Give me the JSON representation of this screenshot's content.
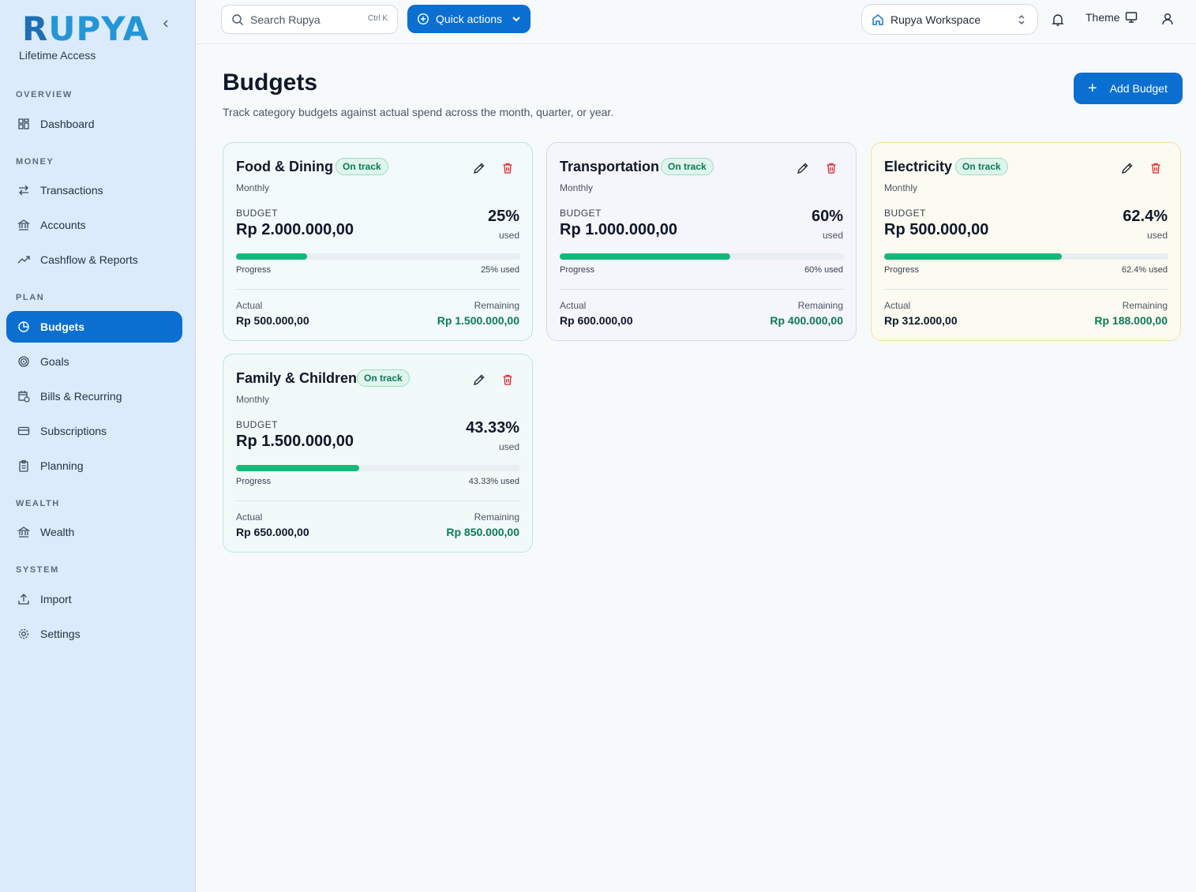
{
  "brand": {
    "name_first": "R",
    "name_rest": "UPYA",
    "subtitle": "Lifetime Access"
  },
  "sidebar": {
    "sections": [
      {
        "title": "OVERVIEW",
        "items": [
          {
            "label": "Dashboard",
            "icon": "dashboard-icon"
          }
        ]
      },
      {
        "title": "MONEY",
        "items": [
          {
            "label": "Transactions",
            "icon": "transfer-icon"
          },
          {
            "label": "Accounts",
            "icon": "bank-icon"
          },
          {
            "label": "Cashflow & Reports",
            "icon": "trend-icon"
          }
        ]
      },
      {
        "title": "PLAN",
        "items": [
          {
            "label": "Budgets",
            "icon": "pie-chart-icon",
            "active": true
          },
          {
            "label": "Goals",
            "icon": "target-icon"
          },
          {
            "label": "Bills & Recurring",
            "icon": "calendar-clock-icon"
          },
          {
            "label": "Subscriptions",
            "icon": "credit-card-icon"
          },
          {
            "label": "Planning",
            "icon": "clipboard-icon"
          }
        ]
      },
      {
        "title": "WEALTH",
        "items": [
          {
            "label": "Wealth",
            "icon": "bank-icon"
          }
        ]
      },
      {
        "title": "SYSTEM",
        "items": [
          {
            "label": "Import",
            "icon": "upload-icon"
          },
          {
            "label": "Settings",
            "icon": "gear-icon"
          }
        ]
      }
    ]
  },
  "topbar": {
    "search_placeholder": "Search Rupya",
    "search_shortcut": "Ctrl K",
    "quick_actions": "Quick actions",
    "workspace": "Rupya Workspace",
    "theme": "Theme"
  },
  "page": {
    "title": "Budgets",
    "subtitle": "Track category budgets against actual spend across the month, quarter, or year.",
    "add_button": "Add Budget"
  },
  "labels": {
    "budget": "BUDGET",
    "used": "used",
    "progress": "Progress",
    "actual": "Actual",
    "remaining": "Remaining"
  },
  "colors": {
    "accent": "#0a6fd1",
    "progress": "#16b77a",
    "remaining": "#0c7a55"
  },
  "budgets": [
    {
      "name": "Food & Dining",
      "status": "On track",
      "period": "Monthly",
      "budget": "Rp 2.000.000,00",
      "percent": "25%",
      "percent_label": "25% used",
      "progress": 0.25,
      "actual": "Rp 500.000,00",
      "remaining": "Rp 1.500.000,00"
    },
    {
      "name": "Transportation",
      "status": "On track",
      "period": "Monthly",
      "budget": "Rp 1.000.000,00",
      "percent": "60%",
      "percent_label": "60% used",
      "progress": 0.6,
      "actual": "Rp 600.000,00",
      "remaining": "Rp 400.000,00"
    },
    {
      "name": "Electricity",
      "status": "On track",
      "period": "Monthly",
      "budget": "Rp 500.000,00",
      "percent": "62.4%",
      "percent_label": "62.4% used",
      "progress": 0.624,
      "actual": "Rp 312.000,00",
      "remaining": "Rp 188.000,00"
    },
    {
      "name": "Family & Children",
      "status": "On track",
      "period": "Monthly",
      "budget": "Rp 1.500.000,00",
      "percent": "43.33%",
      "percent_label": "43.33% used",
      "progress": 0.4333,
      "actual": "Rp 650.000,00",
      "remaining": "Rp 850.000,00"
    }
  ]
}
